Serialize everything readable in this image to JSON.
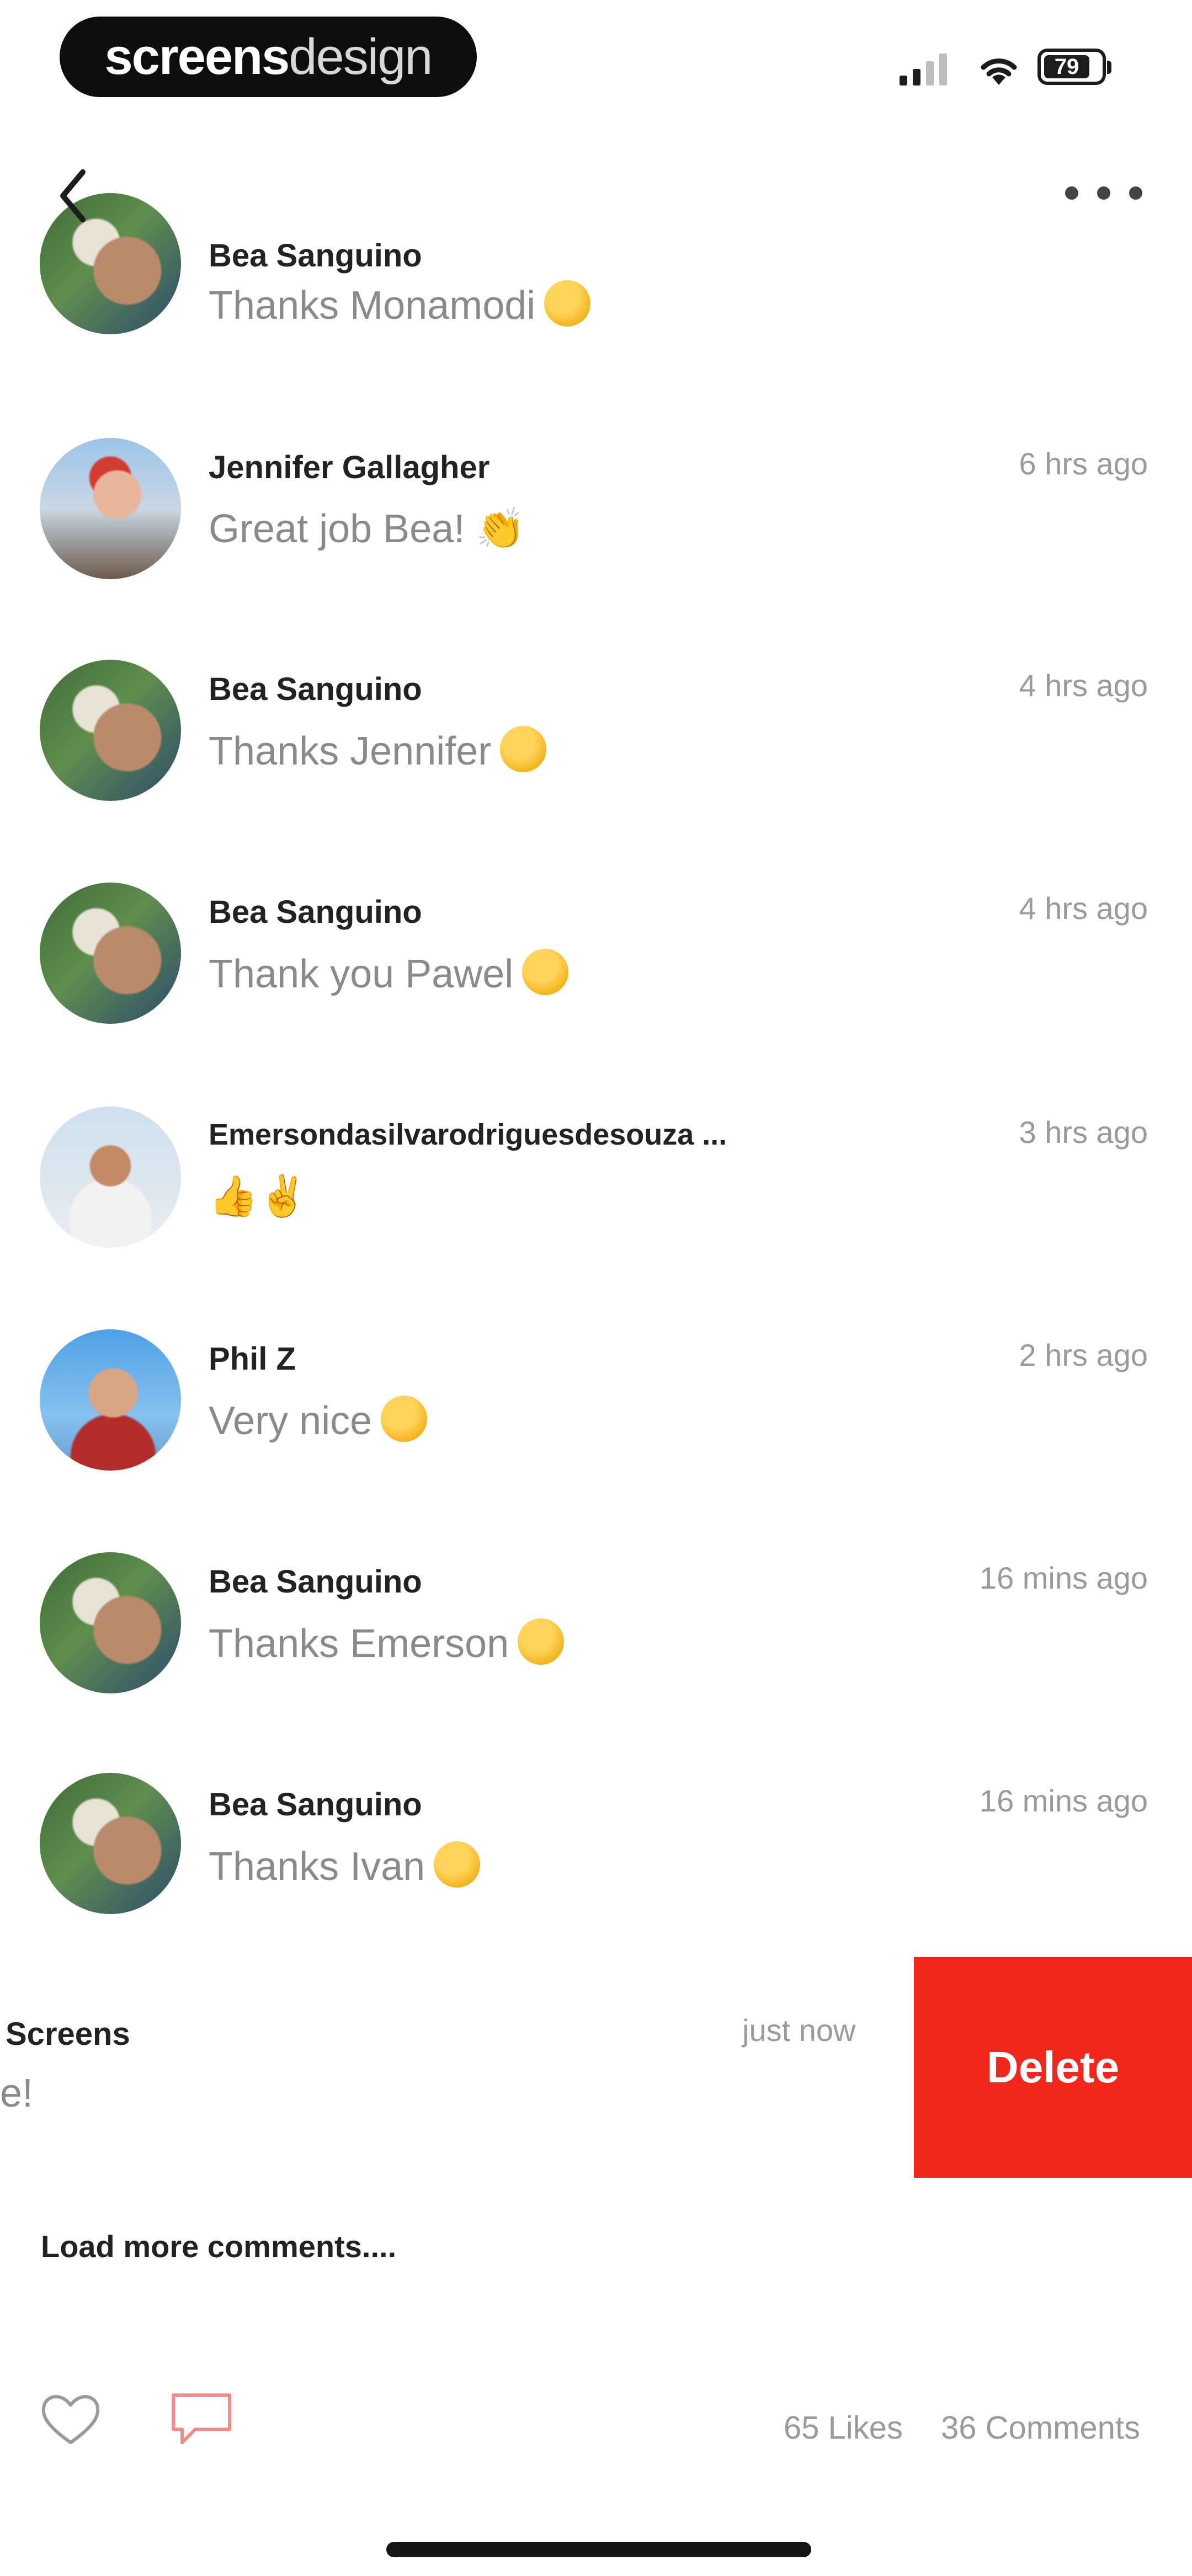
{
  "status_bar": {
    "brand_bold": "screens",
    "brand_light": "design",
    "battery": "79",
    "icons": [
      "signal-icon",
      "wifi-icon",
      "battery-icon"
    ]
  },
  "nav": {
    "back_icon": "chevron-left-icon",
    "more_icon": "more-horizontal-icon"
  },
  "comments": [
    {
      "name": "Bea Sanguino",
      "text": "Thanks Monamodi",
      "time": "",
      "emoji": true
    },
    {
      "name": "Jennifer Gallagher",
      "text": "Great job Bea! 👏",
      "time": "6 hrs ago",
      "emoji": false
    },
    {
      "name": "Bea Sanguino",
      "text": "Thanks Jennifer",
      "time": "4 hrs ago",
      "emoji": true
    },
    {
      "name": "Bea Sanguino",
      "text": "Thank you Pawel",
      "time": "4 hrs ago",
      "emoji": true
    },
    {
      "name": "Emersondasilvarodriguesdesouza ...",
      "text": "👍✌️",
      "time": "3 hrs ago",
      "emoji": false
    },
    {
      "name": "Phil Z",
      "text": "Very nice",
      "time": "2 hrs ago",
      "emoji": true
    },
    {
      "name": "Bea Sanguino",
      "text": "Thanks Emerson",
      "time": "16 mins ago",
      "emoji": true
    },
    {
      "name": "Bea Sanguino",
      "text": "Thanks Ivan",
      "time": "16 mins ago",
      "emoji": true
    }
  ],
  "swiped_comment": {
    "name": "Screens",
    "text": "e!",
    "time": "just now",
    "delete_label": "Delete"
  },
  "load_more": "Load more comments....",
  "footer": {
    "likes": "65 Likes",
    "comments": "36 Comments"
  },
  "colors": {
    "delete": "#f0281c",
    "accent": "#f5b623"
  }
}
